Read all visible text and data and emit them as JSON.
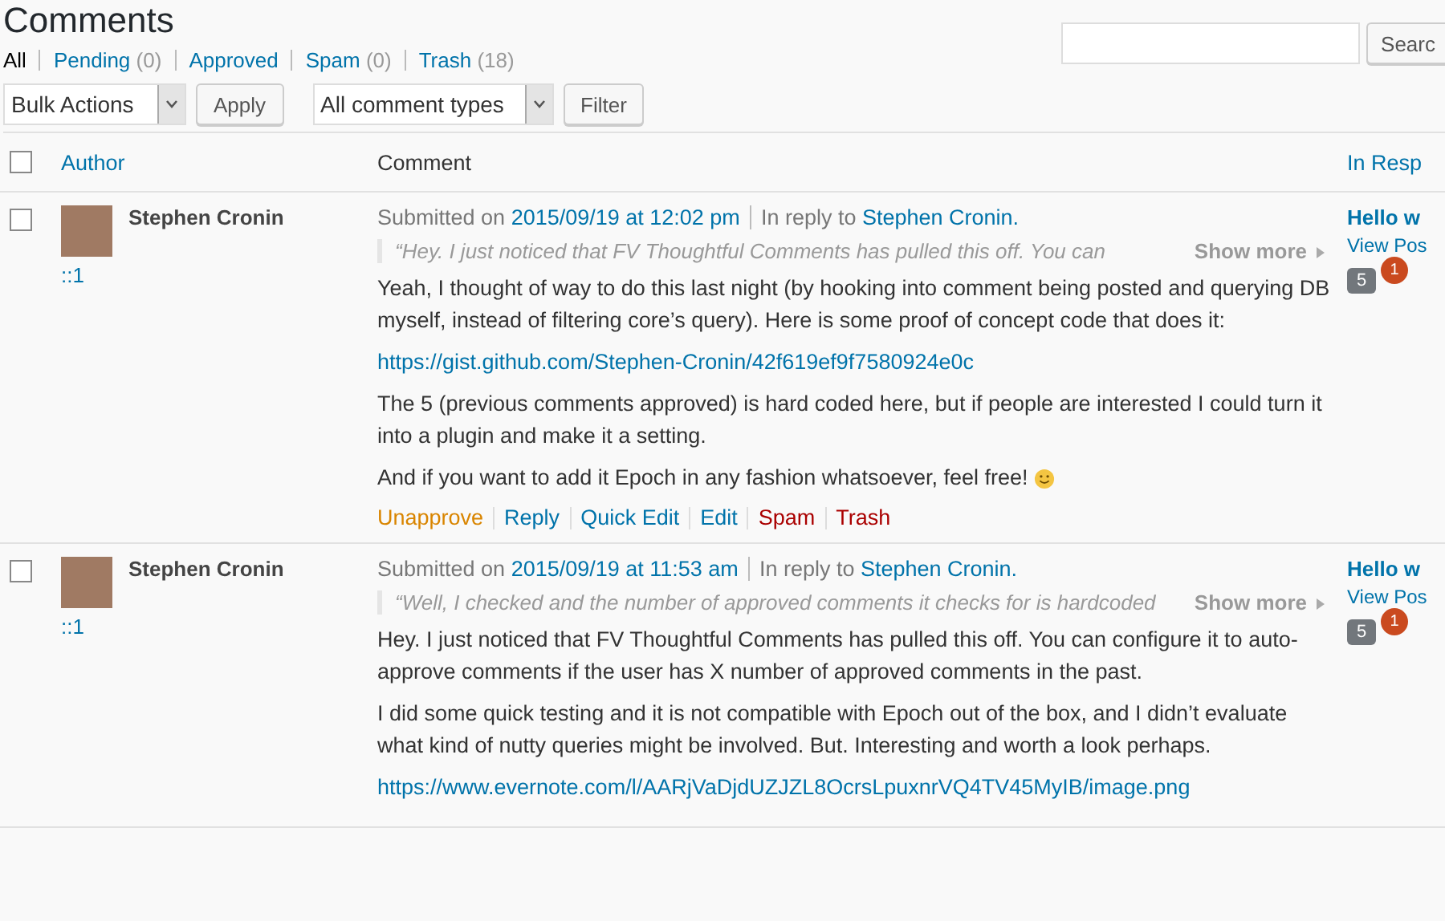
{
  "title": "Comments",
  "filters": [
    {
      "label": "All",
      "selected": true
    },
    {
      "label": "Pending",
      "count": "(0)",
      "selected": false
    },
    {
      "label": "Approved",
      "selected": false
    },
    {
      "label": "Spam",
      "count": "(0)",
      "selected": false
    },
    {
      "label": "Trash",
      "count": "(18)",
      "selected": false
    }
  ],
  "search": {
    "button": "Searc"
  },
  "toolbar": {
    "bulk_actions": "Bulk Actions",
    "apply": "Apply",
    "type_filter": "All comment types",
    "filter": "Filter"
  },
  "columns": [
    {
      "label": "Author",
      "sortable": true
    },
    {
      "label": "Comment",
      "sortable": false
    },
    {
      "label": "In Resp",
      "sortable": true
    }
  ],
  "select_all": {
    "checked": false
  },
  "comments": [
    {
      "checked": false,
      "author": "Stephen Cronin",
      "ip": "::1",
      "submitted": "Submitted on",
      "date": "2015/09/19 at 12:02 pm",
      "reply_prefix": "In reply to",
      "reply_to": "Stephen Cronin.",
      "excerpt": "“Hey. I just noticed that FV Thoughtful Comments has pulled this off. You can",
      "show_more": "Show more",
      "paragraphs": [
        {
          "kind": "text",
          "text": "Yeah, I thought of way to do this last night (by hooking into comment being posted and querying DB myself, instead of filtering core’s query). Here is some proof of concept code that does it:",
          "smiley": false
        },
        {
          "kind": "link",
          "text": "https://gist.github.com/Stephen-Cronin/42f619ef9f7580924e0c",
          "smiley": false
        },
        {
          "kind": "text",
          "text": "The 5 (previous comments approved) is hard coded here, but if people are interested I could turn it into a plugin and make it a setting.",
          "smiley": false
        },
        {
          "kind": "text",
          "text": "And if you want to add it Epoch in any fashion whatsoever, feel free!",
          "smiley": true
        }
      ],
      "actions": [
        {
          "label": "Unapprove",
          "kind": "unapprove"
        },
        {
          "label": "Reply",
          "kind": "normal"
        },
        {
          "label": "Quick Edit",
          "kind": "normal"
        },
        {
          "label": "Edit",
          "kind": "normal"
        },
        {
          "label": "Spam",
          "kind": "danger"
        },
        {
          "label": "Trash",
          "kind": "danger"
        }
      ],
      "response": {
        "post": "Hello w",
        "view": "View Pos",
        "count": "5",
        "pending": "1"
      }
    },
    {
      "checked": false,
      "author": "Stephen Cronin",
      "ip": "::1",
      "submitted": "Submitted on",
      "date": "2015/09/19 at 11:53 am",
      "reply_prefix": "In reply to",
      "reply_to": "Stephen Cronin.",
      "excerpt": "“Well, I checked and the number of approved comments it checks for is hardcoded",
      "show_more": "Show more",
      "paragraphs": [
        {
          "kind": "text",
          "text": "Hey. I just noticed that FV Thoughtful Comments has pulled this off. You can configure it to auto-approve comments if the user has X number of approved comments in the past.",
          "smiley": false
        },
        {
          "kind": "text",
          "text": "I did some quick testing and it is not compatible with Epoch out of the box, and I didn’t evaluate what kind of nutty queries might be involved. But. Interesting and worth a look perhaps.",
          "smiley": false
        },
        {
          "kind": "link",
          "text": "https://www.evernote.com/l/AARjVaDjdUZJZL8OcrsLpuxnrVQ4TV45MyIB/image.png",
          "smiley": false
        }
      ],
      "response": {
        "post": "Hello w",
        "view": "View Pos",
        "count": "5",
        "pending": "1"
      }
    }
  ]
}
